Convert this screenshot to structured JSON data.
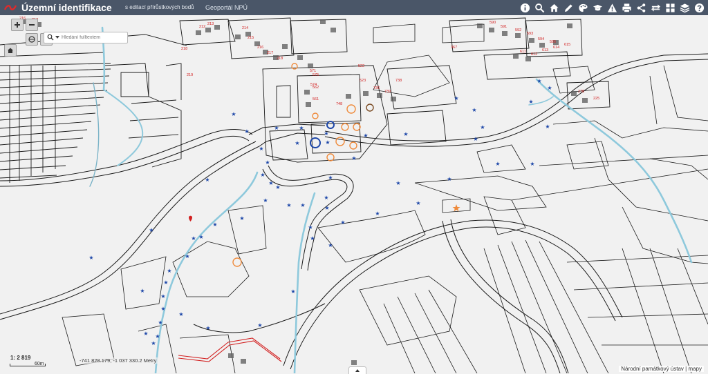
{
  "header": {
    "title": "Územní identifikace",
    "subtitle": "s editací přírůstkových bodů",
    "portal_link": "Geoportál NPÚ",
    "bar_color": "#4a5668"
  },
  "toolbar": [
    {
      "name": "info-icon"
    },
    {
      "name": "search-icon"
    },
    {
      "name": "home-icon"
    },
    {
      "name": "pencil-icon"
    },
    {
      "name": "palette-icon"
    },
    {
      "name": "graduation-cap-icon"
    },
    {
      "name": "warning-icon"
    },
    {
      "name": "print-icon"
    },
    {
      "name": "share-icon"
    },
    {
      "name": "swap-arrows-icon"
    },
    {
      "name": "grid-icon"
    },
    {
      "name": "layers-icon"
    },
    {
      "name": "help-icon"
    }
  ],
  "search": {
    "placeholder": "Hledání fulltextem"
  },
  "status": {
    "scale": "1: 2 819",
    "scale_bar_label": "60m",
    "coordinates": "-741 828.179, -1 037 330.2 Metry"
  },
  "attribution": "Národní památkový ústav | mapy",
  "map_labels": [
    "212",
    "213",
    "214",
    "215",
    "216",
    "217",
    "218",
    "571",
    "574",
    "575",
    "562",
    "561",
    "522",
    "523",
    "738",
    "739",
    "736",
    "748",
    "367",
    "590",
    "591",
    "592",
    "593",
    "594",
    "595",
    "225",
    "278",
    "611",
    "612",
    "613",
    "614",
    "615",
    "216",
    "217",
    "218",
    "219"
  ],
  "colors": {
    "map_background": "#f1f1f1",
    "parcel_line": "#1a1a1a",
    "river": "#8ec9dc",
    "monument_star": "#1c46a8",
    "monument_orange": "#ef8a3a",
    "red_label": "#d22020"
  }
}
